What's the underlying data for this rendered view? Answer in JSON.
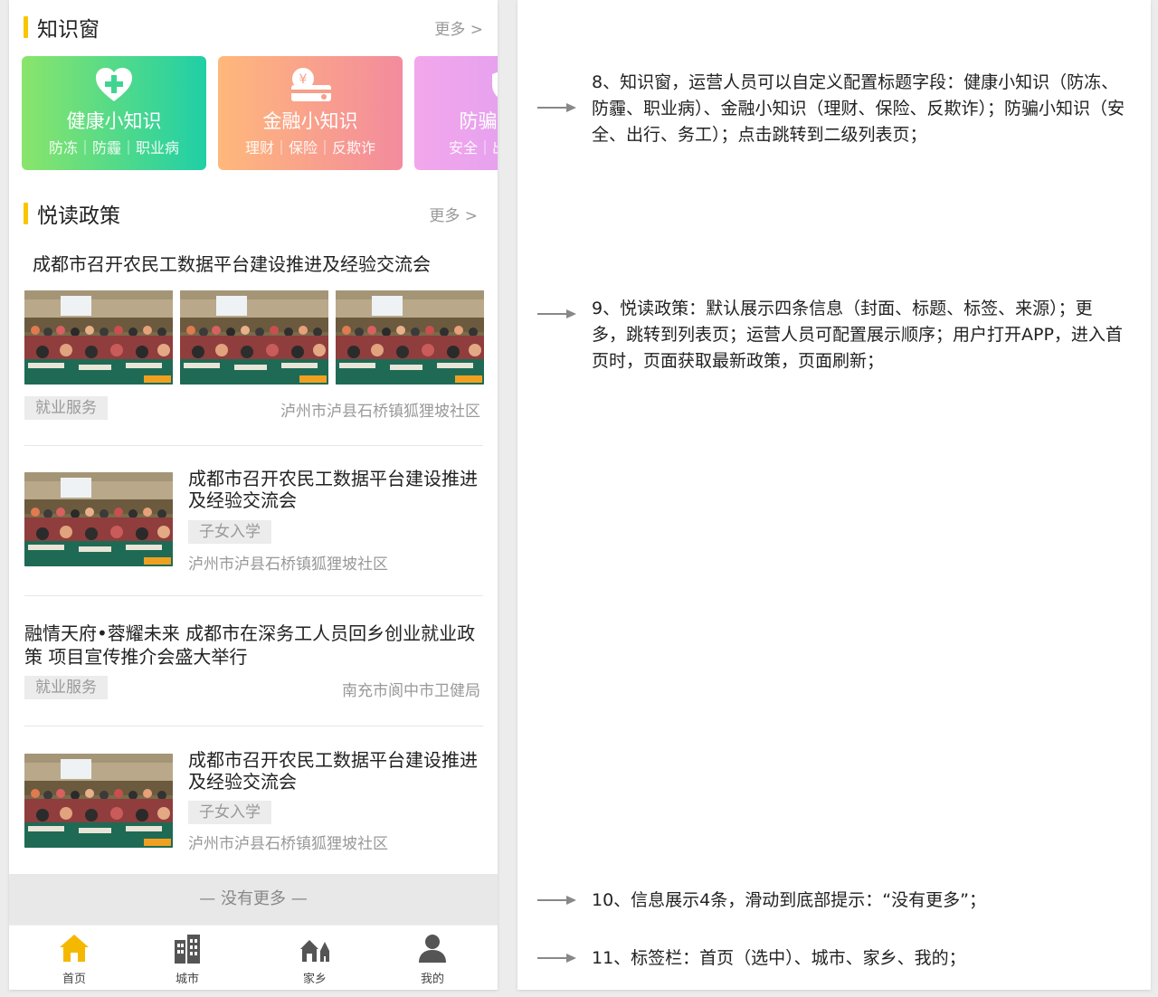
{
  "knowledge": {
    "title": "知识窗",
    "more": "更多 >",
    "cards": [
      {
        "title": "健康小知识",
        "sub": "防冻｜防霾｜职业病",
        "icon": "heart-plus-icon"
      },
      {
        "title": "金融小知识",
        "sub": "理财｜保险｜反欺诈",
        "icon": "money-card-icon"
      },
      {
        "title": "防骗小知识",
        "sub": "安全｜出行｜务工",
        "icon": "shield-icon"
      }
    ]
  },
  "policy": {
    "title": "悦读政策",
    "more": "更多 >",
    "items": [
      {
        "title": "成都市召开农民工数据平台建设推进及经验交流会",
        "tag": "就业服务",
        "source": "泸州市泸县石桥镇狐狸坡社区"
      },
      {
        "title": "成都市召开农民工数据平台建设推进及经验交流会",
        "tag": "子女入学",
        "source": "泸州市泸县石桥镇狐狸坡社区"
      },
      {
        "title": "融情天府•蓉耀未来 成都市在深务工人员回乡创业就业政策 项目宣传推介会盛大举行",
        "tag": "就业服务",
        "source": "南充市阆中市卫健局"
      },
      {
        "title": "成都市召开农民工数据平台建设推进及经验交流会",
        "tag": "子女入学",
        "source": "泸州市泸县石桥镇狐狸坡社区"
      }
    ]
  },
  "no_more": "— 没有更多 —",
  "tabs": [
    {
      "label": "首页",
      "icon": "home-icon",
      "selected": true
    },
    {
      "label": "城市",
      "icon": "city-icon",
      "selected": false
    },
    {
      "label": "家乡",
      "icon": "hometown-icon",
      "selected": false
    },
    {
      "label": "我的",
      "icon": "profile-icon",
      "selected": false
    }
  ],
  "notes": [
    "8、知识窗，运营人员可以自定义配置标题字段：健康小知识（防冻、防霾、职业病）、金融小知识（理财、保险、反欺诈）；防骗小知识（安全、出行、务工）；点击跳转到二级列表页；",
    "9、悦读政策：默认展示四条信息（封面、标题、标签、来源）；更多，跳转到列表页；运营人员可配置展示顺序；用户打开APP，进入首页时，页面获取最新政策，页面刷新；",
    "10、信息展示4条，滑动到底部提示：“没有更多”；",
    "11、标签栏：首页（选中）、城市、家乡、我的；"
  ],
  "colors": {
    "accent": "#f7c600",
    "tab_selected": "#f5b800",
    "tab_icon": "#555555"
  }
}
